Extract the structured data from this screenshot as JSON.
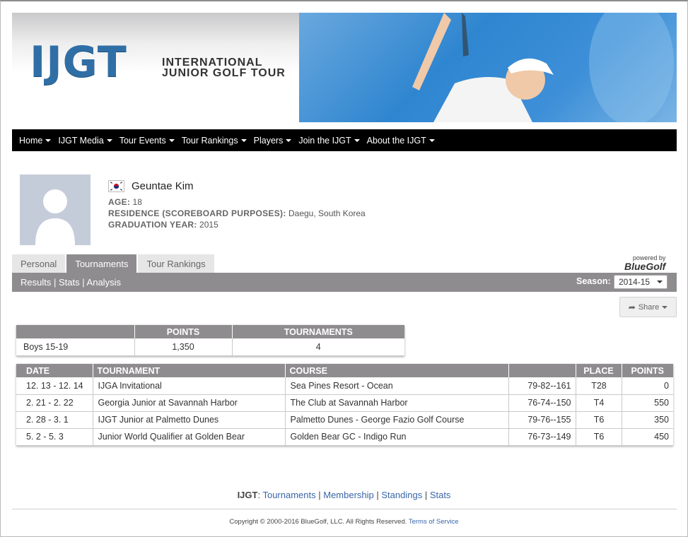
{
  "logo": {
    "letters": "IJGT",
    "line1": "INTERNATIONAL",
    "line2": "JUNIOR GOLF TOUR"
  },
  "nav": [
    "Home",
    "IJGT Media",
    "Tour Events",
    "Tour Rankings",
    "Players",
    "Join the IJGT",
    "About the IJGT"
  ],
  "player": {
    "name": "Geuntae Kim",
    "age_label": "AGE:",
    "age": "18",
    "residence_label": "RESIDENCE (SCOREBOARD PURPOSES):",
    "residence": "Daegu, South Korea",
    "grad_label": "GRADUATION YEAR:",
    "grad": "2015"
  },
  "tabs": [
    "Personal",
    "Tournaments",
    "Tour Rankings"
  ],
  "powered": {
    "line1": "powered by",
    "line2": "BlueGolf"
  },
  "subnav": {
    "results": "Results",
    "stats": "Stats",
    "analysis": "Analysis",
    "sep": "|"
  },
  "season": {
    "label": "Season:",
    "value": "2014-15"
  },
  "share": {
    "label": "Share"
  },
  "summary": {
    "headers": [
      "",
      "POINTS",
      "TOURNAMENTS"
    ],
    "row": [
      "Boys 15-19",
      "1,350",
      "4"
    ]
  },
  "results": {
    "headers": [
      "DATE",
      "TOURNAMENT",
      "COURSE",
      "",
      "PLACE",
      "POINTS"
    ],
    "rows": [
      [
        "12. 13 - 12. 14",
        "IJGA Invitational",
        "Sea Pines Resort - Ocean",
        "79-82--161",
        "T28",
        "0"
      ],
      [
        "2. 21 - 2. 22",
        "Georgia Junior at Savannah Harbor",
        "The Club at Savannah Harbor",
        "76-74--150",
        "T4",
        "550"
      ],
      [
        "2. 28 - 3. 1",
        "IJGT Junior at Palmetto Dunes",
        "Palmetto Dunes - George Fazio Golf Course",
        "79-76--155",
        "T6",
        "350"
      ],
      [
        "5. 2 - 5. 3",
        "Junior World Qualifier at Golden Bear",
        "Golden Bear GC - Indigo Run",
        "76-73--149",
        "T6",
        "450"
      ]
    ]
  },
  "footer": {
    "prefix": "IJGT",
    "links": [
      "Tournaments",
      "Membership",
      "Standings",
      "Stats"
    ],
    "copyright": "Copyright © 2000-2016 BlueGolf, LLC. All Rights Reserved.",
    "terms": "Terms of Service"
  }
}
